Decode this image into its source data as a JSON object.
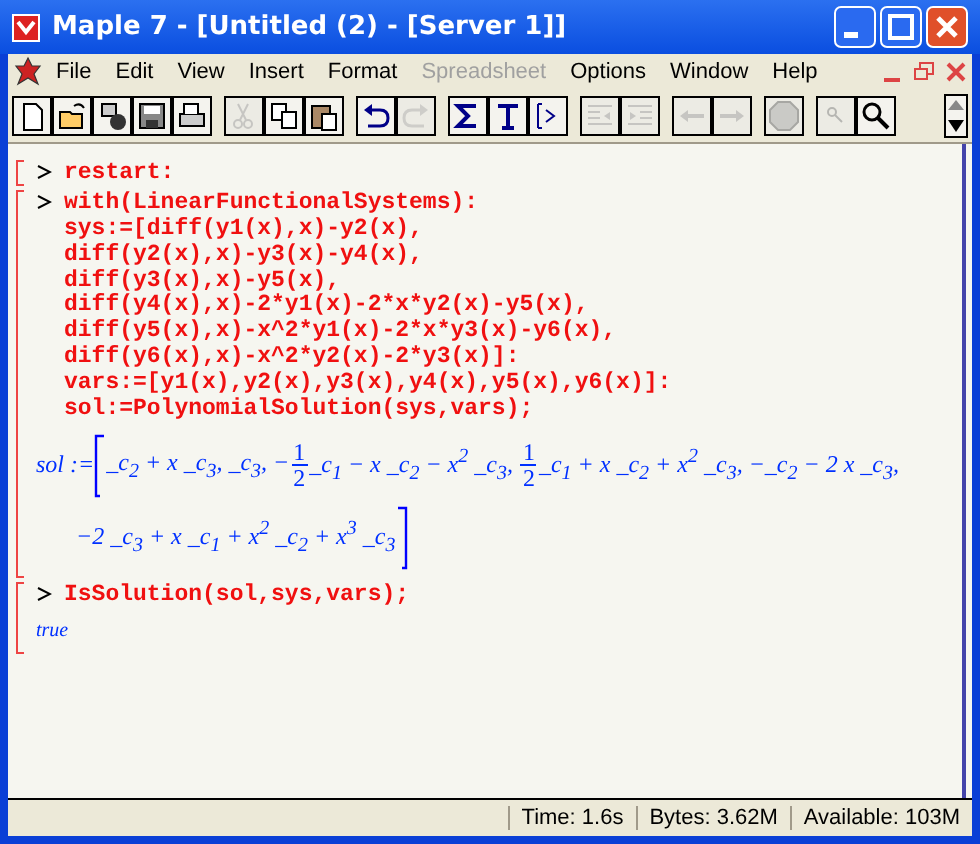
{
  "window": {
    "title": "Maple 7  - [Untitled (2) - [Server 1]]"
  },
  "menu": [
    {
      "label": "File",
      "disabled": false
    },
    {
      "label": "Edit",
      "disabled": false
    },
    {
      "label": "View",
      "disabled": false
    },
    {
      "label": "Insert",
      "disabled": false
    },
    {
      "label": "Format",
      "disabled": false
    },
    {
      "label": "Spreadsheet",
      "disabled": true
    },
    {
      "label": "Options",
      "disabled": false
    },
    {
      "label": "Window",
      "disabled": false
    },
    {
      "label": "Help",
      "disabled": false
    }
  ],
  "toolbar": [
    [
      {
        "kind": "new",
        "disabled": false
      },
      {
        "kind": "open",
        "disabled": false
      },
      {
        "kind": "server",
        "disabled": false
      },
      {
        "kind": "save",
        "disabled": false
      },
      {
        "kind": "print",
        "disabled": false
      }
    ],
    [
      {
        "kind": "cut",
        "disabled": true
      },
      {
        "kind": "copy",
        "disabled": false
      },
      {
        "kind": "paste",
        "disabled": false
      }
    ],
    [
      {
        "kind": "undo",
        "disabled": false
      },
      {
        "kind": "redo",
        "disabled": true
      }
    ],
    [
      {
        "kind": "sigma",
        "disabled": false
      },
      {
        "kind": "text",
        "disabled": false
      },
      {
        "kind": "prompt",
        "disabled": false
      }
    ],
    [
      {
        "kind": "outdent",
        "disabled": true
      },
      {
        "kind": "indent",
        "disabled": true
      }
    ],
    [
      {
        "kind": "back",
        "disabled": true
      },
      {
        "kind": "forward",
        "disabled": true
      }
    ],
    [
      {
        "kind": "stop",
        "disabled": true
      }
    ],
    [
      {
        "kind": "zoom-small",
        "disabled": true
      },
      {
        "kind": "zoom-large",
        "disabled": false
      }
    ]
  ],
  "groups": [
    {
      "input": [
        "restart:"
      ]
    },
    {
      "input": [
        "with(LinearFunctionalSystems):",
        "sys:=[diff(y1(x),x)-y2(x),",
        "diff(y2(x),x)-y3(x)-y4(x),",
        "diff(y3(x),x)-y5(x),",
        "diff(y4(x),x)-2*y1(x)-2*x*y2(x)-y5(x),",
        "diff(y5(x),x)-x^2*y1(x)-2*x*y3(x)-y6(x),",
        "diff(y6(x),x)-x^2*y2(x)-2*y3(x)]:",
        "vars:=[y1(x),y2(x),y3(x),y4(x),y5(x),y6(x)]:",
        "sol:=PolynomialSolution(sys,vars);"
      ],
      "output": {
        "kind": "math",
        "lhs": "sol :=",
        "lines": [
          [
            {
              "kind": "text",
              "text": "_c$_{2}$ + x _c$_{3}$, _c$_{3}$, −"
            },
            {
              "kind": "frac",
              "num": "1",
              "den": "2"
            },
            {
              "kind": "text",
              "text": "_c$_{1}$ − x _c$_{2}$ − x$^{2}$ _c$_{3}$, "
            },
            {
              "kind": "frac",
              "num": "1",
              "den": "2"
            },
            {
              "kind": "text",
              "text": "_c$_{1}$ + x _c$_{2}$ + x$^{2}$ _c$_{3}$, −_c$_{2}$ − 2 x _c$_{3}$,"
            }
          ],
          [
            {
              "kind": "text",
              "text": "−2 _c$_{3}$ + x _c$_{1}$ + x$^{2}$ _c$_{2}$ + x$^{3}$ _c$_{3}$"
            }
          ]
        ]
      }
    },
    {
      "input": [
        "IsSolution(sol,sys,vars);"
      ],
      "output": {
        "kind": "plain",
        "text": "true"
      }
    }
  ],
  "status_bar": [
    "Time:  1.6s",
    "Bytes: 3.62M",
    "Available: 103M"
  ]
}
